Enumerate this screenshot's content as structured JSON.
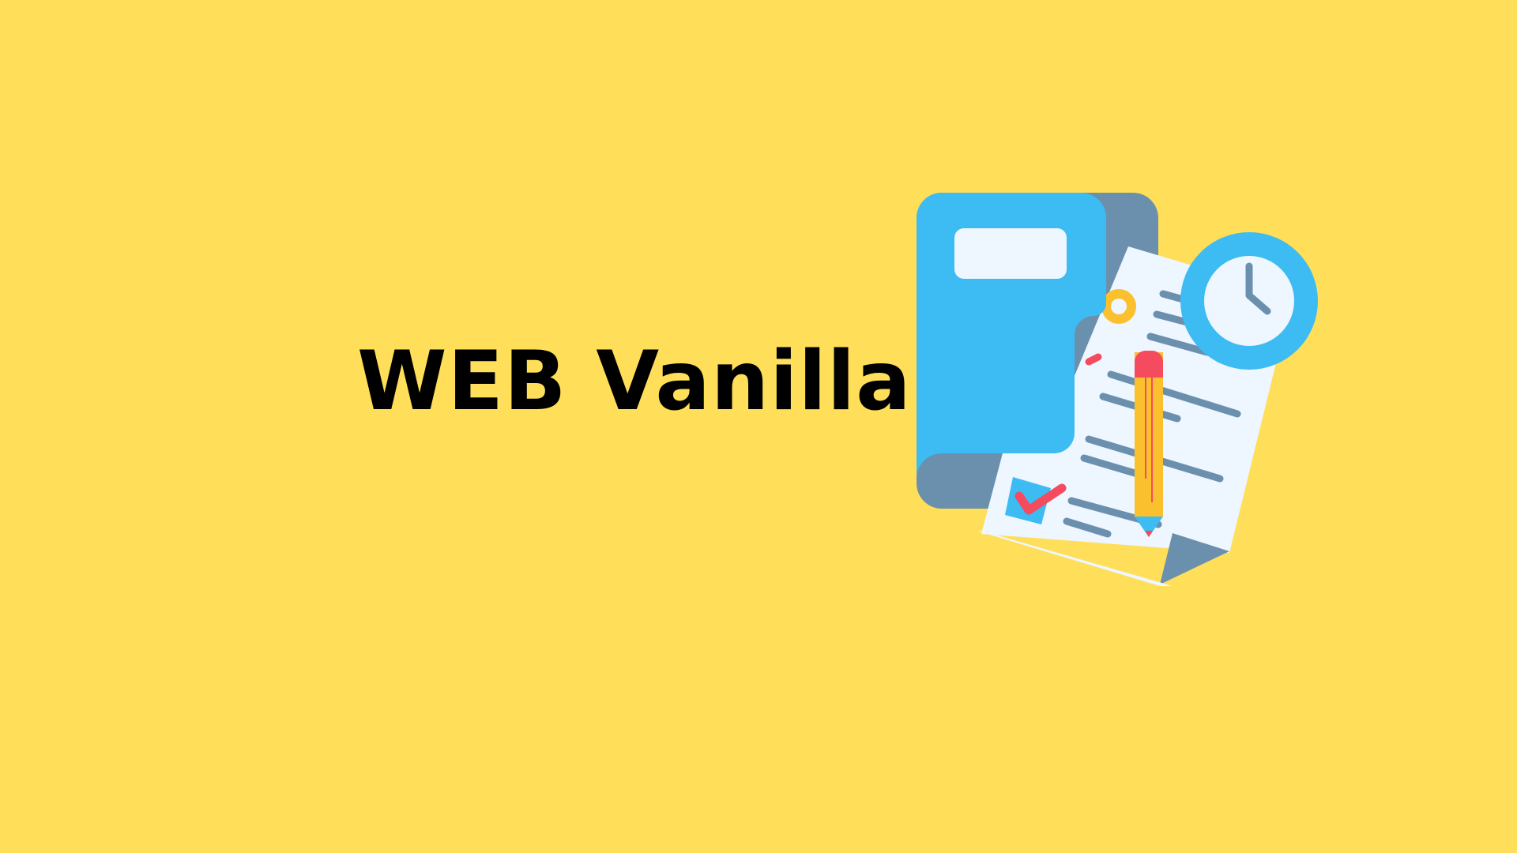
{
  "banner": {
    "title": "WEB Vanilla",
    "background_color": "#FFDE59",
    "title_color": "#000000"
  },
  "illustration": {
    "icons": [
      "folder-icon",
      "document-icon",
      "clock-icon",
      "pencil-icon",
      "checkbox-icon",
      "gear-icon"
    ],
    "colors": {
      "folder_front": "#3DBBF3",
      "folder_back": "#6B90AE",
      "paper": "#EEF6FF",
      "lines": "#6B90AE",
      "accent_red": "#F44B5E",
      "pencil_yellow": "#FBC02D",
      "clock_ring": "#3DBBF3",
      "clock_hands": "#6B90AE"
    }
  }
}
